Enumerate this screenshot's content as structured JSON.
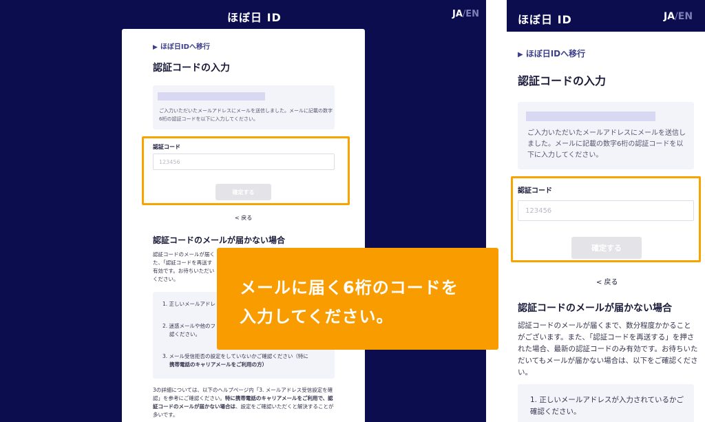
{
  "logo": "ほぼ日 ID",
  "lang": {
    "ja": "JA",
    "sep": "/",
    "en": "EN"
  },
  "migrate_link": "ほぼ日IDへ移行",
  "page_title": "認証コードの入力",
  "info": {
    "desk_text": "ご入力いただいたメールアドレスにメールを送信しました。メールに記載の数字6桁の認証コードを以下に入力してください。",
    "mob_text": "ご入力いただいたメールアドレスにメールを送信しました。メールに記載の数字6桁の認証コードを以下に入力してください。"
  },
  "code_label": "認証コード",
  "code_placeholder": "123456",
  "confirm_button": "確定する",
  "back_link": "< 戻る",
  "not_received_title": "認証コードのメールが届かない場合",
  "desk_body": [
    "認証コードのメールが届く",
    "た、「認証コードを再送す",
    "有効です。お待ちいただい",
    "ください。"
  ],
  "mob_body": "認証コードのメールが届くまで、数分程度かかることがございます。また、「認証コードを再送する」を押された場合、最新の認証コードのみ有効です。お待ちいただいてもメールが届かない場合は、以下をご確認ください。",
  "checks_desk": {
    "item1": "1. 正しいメールアドレ",
    "item2_line1": "2. 迷惑メールや他のフ",
    "item2_line2": "認ください。",
    "item3_line1": "3. メール受信拒否の設定をしていないかご確認ください（特に",
    "item3_line2": "携帯電話のキャリアメールをご利用の方）"
  },
  "check_mob_item1": "1. 正しいメールアドレスが入力されているかご確認ください。",
  "footer": {
    "part1": "3の詳細については、以下のヘルプページ内「3. メールアドレス受信設定を確認」を参考にご確認ください。",
    "part2": "特に携帯電話のキャリアメールをご利用で、認証コードのメールが届かない場合は",
    "part3": "、設定をご確認いただくと解決することが多いです。"
  },
  "callout": {
    "line1": "メールに届く6桁のコードを",
    "line2": "入力してください。"
  },
  "colors": {
    "navy": "#0b0d4f",
    "accent_orange": "#f99c00",
    "highlight_border": "#f7a400"
  }
}
